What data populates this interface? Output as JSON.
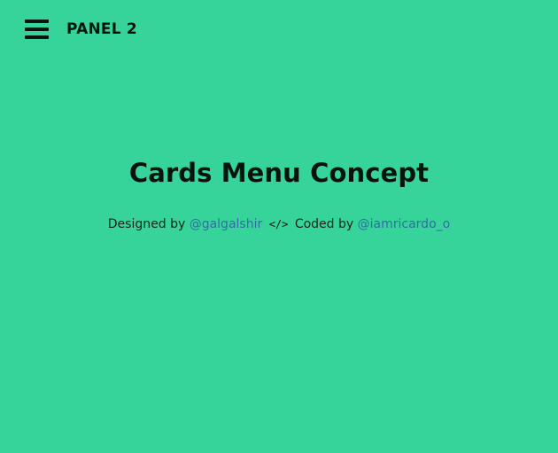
{
  "header": {
    "menu_icon": "hamburger-menu-icon",
    "title": "PANEL 2"
  },
  "hero": {
    "title": "Cards Menu Concept",
    "credits": {
      "designed_prefix": "Designed by",
      "designer_handle": "@galgalshir",
      "code_symbol": "</>",
      "code_icon": "code-icon",
      "coded_prefix": "Coded by",
      "coder_handle": "@iamricardo_o"
    }
  },
  "colors": {
    "background": "#36d49a",
    "link": "#2f6fa1",
    "text": "#0b1410"
  }
}
